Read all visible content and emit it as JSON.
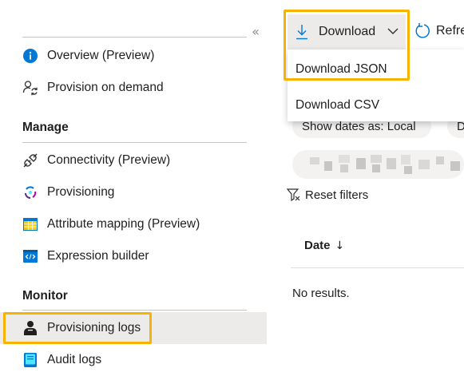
{
  "sidebar": {
    "items_top": [
      {
        "label": "Overview (Preview)",
        "icon": "info-icon"
      },
      {
        "label": "Provision on demand",
        "icon": "person-sync-icon"
      }
    ],
    "sections": [
      {
        "title": "Manage",
        "items": [
          {
            "label": "Connectivity (Preview)",
            "icon": "plug-icon"
          },
          {
            "label": "Provisioning",
            "icon": "provisioning-cycle-icon"
          },
          {
            "label": "Attribute mapping (Preview)",
            "icon": "table-icon"
          },
          {
            "label": "Expression builder",
            "icon": "code-icon"
          }
        ]
      },
      {
        "title": "Monitor",
        "items": [
          {
            "label": "Provisioning logs",
            "icon": "person-log-icon",
            "selected": true
          },
          {
            "label": "Audit logs",
            "icon": "book-icon"
          }
        ]
      }
    ],
    "collapse_glyph": "«"
  },
  "toolbar": {
    "download_label": "Download",
    "refresh_label": "Refre"
  },
  "download_menu": {
    "items": [
      "Download JSON",
      "Download CSV"
    ]
  },
  "filters": {
    "show_dates_chip": "Show dates as: Local",
    "second_chip": "D",
    "reset_label": "Reset filters"
  },
  "grid": {
    "column_date": "Date",
    "sort_arrow": "↓",
    "empty_message": "No results."
  },
  "colors": {
    "highlight": "#f8b200",
    "accent": "#0078d4",
    "selected_bg": "#edebe9"
  }
}
